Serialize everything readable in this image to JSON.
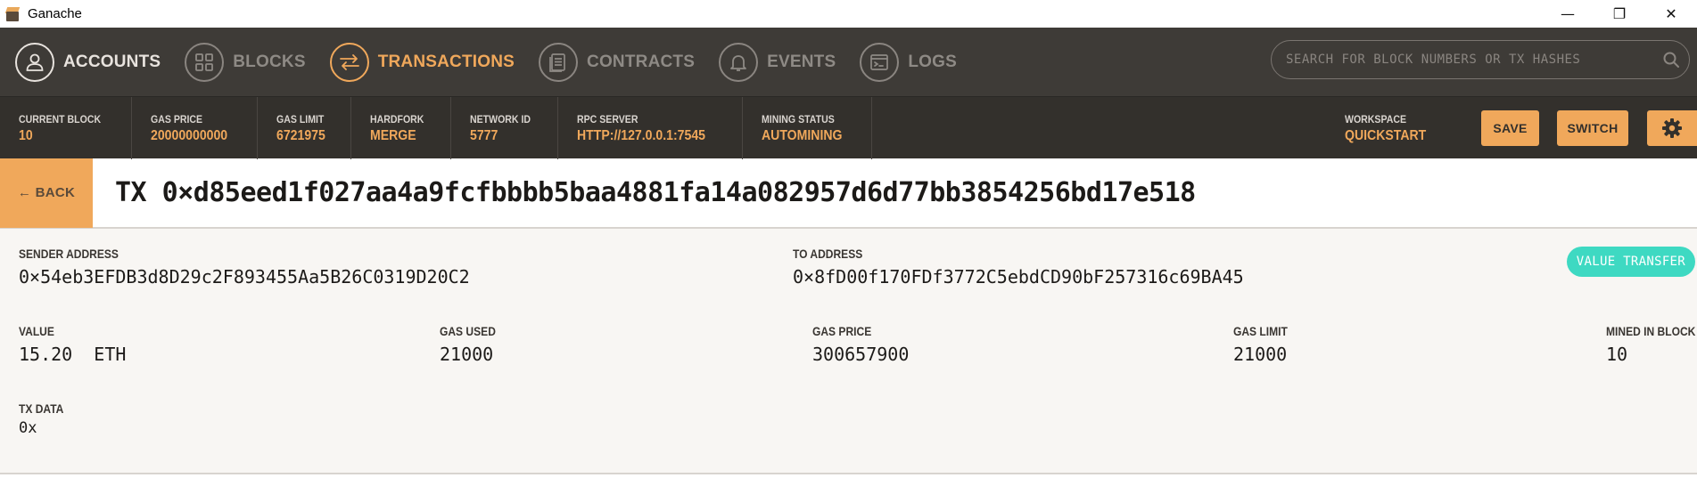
{
  "window": {
    "title": "Ganache",
    "minimize": "—",
    "restore": "❐",
    "close": "✕"
  },
  "nav": {
    "items": [
      {
        "label": "ACCOUNTS",
        "icon": "user-icon"
      },
      {
        "label": "BLOCKS",
        "icon": "grid-icon"
      },
      {
        "label": "TRANSACTIONS",
        "icon": "swap-arrows-icon",
        "active": true
      },
      {
        "label": "CONTRACTS",
        "icon": "document-icon"
      },
      {
        "label": "EVENTS",
        "icon": "bell-icon"
      },
      {
        "label": "LOGS",
        "icon": "terminal-icon"
      }
    ],
    "search_placeholder": "SEARCH FOR BLOCK NUMBERS OR TX HASHES"
  },
  "status": {
    "items": [
      {
        "label": "CURRENT BLOCK",
        "value": "10"
      },
      {
        "label": "GAS PRICE",
        "value": "20000000000"
      },
      {
        "label": "GAS LIMIT",
        "value": "6721975"
      },
      {
        "label": "HARDFORK",
        "value": "MERGE"
      },
      {
        "label": "NETWORK ID",
        "value": "5777"
      },
      {
        "label": "RPC SERVER",
        "value": "HTTP://127.0.0.1:7545"
      },
      {
        "label": "MINING STATUS",
        "value": "AUTOMINING"
      }
    ],
    "workspace_label": "WORKSPACE",
    "workspace_value": "QUICKSTART",
    "save_label": "SAVE",
    "switch_label": "SWITCH"
  },
  "tx": {
    "back_label": "← BACK",
    "title": "TX 0×d85eed1f027aa4a9fcfbbbb5baa4881fa14a082957d6d77bb3854256bd17e518",
    "badge": "VALUE TRANSFER",
    "sender_label": "SENDER ADDRESS",
    "sender_value": "0×54eb3EFDB3d8D29c2F893455Aa5B26C0319D20C2",
    "to_label": "TO ADDRESS",
    "to_value": "0×8fD00f170FDf3772C5ebdCD90bF257316c69BA45",
    "value_label": "VALUE",
    "value_value": "15.20  ETH",
    "gas_used_label": "GAS USED",
    "gas_used_value": "21000",
    "gas_price_label": "GAS PRICE",
    "gas_price_value": "300657900",
    "gas_limit_label": "GAS LIMIT",
    "gas_limit_value": "21000",
    "mined_label": "MINED IN BLOCK",
    "mined_value": "10",
    "txdata_label": "TX DATA",
    "txdata_value": "0x"
  },
  "colors": {
    "accent": "#f0a85b",
    "nav_bg": "#3e3b37",
    "status_bg": "#33302c",
    "badge": "#3ed9c2"
  }
}
